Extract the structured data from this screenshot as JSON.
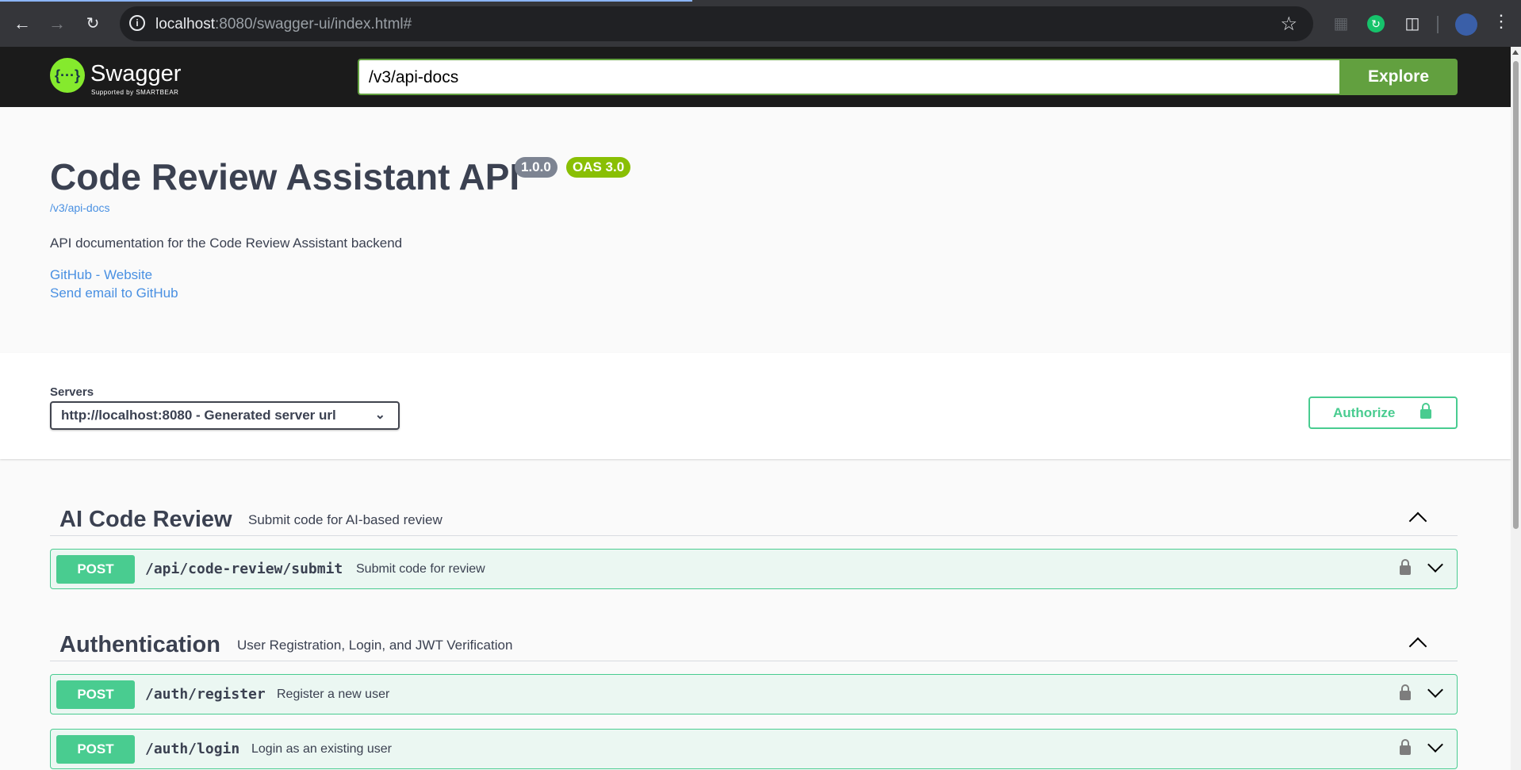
{
  "browser": {
    "url_host": "localhost",
    "url_rest": ":8080/swagger-ui/index.html#"
  },
  "topbar": {
    "logo_text": "Swagger",
    "logo_sub": "Supported by SMARTBEAR",
    "spec_url": "/v3/api-docs",
    "explore_label": "Explore"
  },
  "info": {
    "title": "Code Review Assistant API",
    "version": "1.0.0",
    "oas": "OAS 3.0",
    "spec_link": "/v3/api-docs",
    "description": "API documentation for the Code Review Assistant backend",
    "links": [
      "GitHub - Website",
      "Send email to GitHub"
    ]
  },
  "servers": {
    "label": "Servers",
    "selected": "http://localhost:8080 - Generated server url",
    "authorize_label": "Authorize"
  },
  "tags": [
    {
      "name": "AI Code Review",
      "description": "Submit code for AI-based review",
      "operations": [
        {
          "method": "POST",
          "path": "/api/code-review/submit",
          "summary": "Submit code for review"
        }
      ]
    },
    {
      "name": "Authentication",
      "description": "User Registration, Login, and JWT Verification",
      "operations": [
        {
          "method": "POST",
          "path": "/auth/register",
          "summary": "Register a new user"
        },
        {
          "method": "POST",
          "path": "/auth/login",
          "summary": "Login as an existing user"
        }
      ]
    }
  ],
  "colors": {
    "post": "#49cc90",
    "explore": "#62a03f",
    "link": "#4990e2"
  }
}
